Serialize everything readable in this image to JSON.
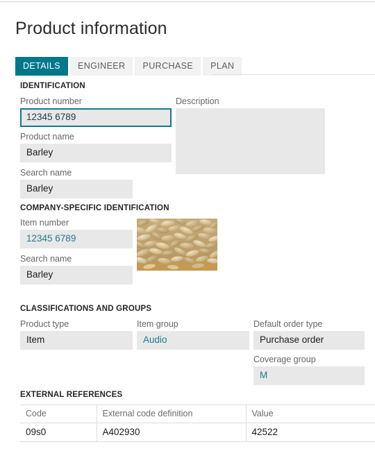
{
  "page": {
    "title": "Product information"
  },
  "tabs": [
    {
      "label": "DETAILS",
      "active": true
    },
    {
      "label": "ENGINEER",
      "active": false
    },
    {
      "label": "PURCHASE",
      "active": false
    },
    {
      "label": "PLAN",
      "active": false
    }
  ],
  "sections": {
    "identification": "IDENTIFICATION",
    "company_specific": "COMPANY-SPECIFIC IDENTIFICATION",
    "classifications": "CLASSIFICATIONS AND GROUPS",
    "external_references": "EXTERNAL REFERENCES"
  },
  "fields": {
    "product_number": {
      "label": "Product number",
      "value": "12345 6789",
      "placeholder": ""
    },
    "product_name": {
      "label": "Product name",
      "value": "Barley",
      "placeholder": ""
    },
    "search_name_1": {
      "label": "Search name",
      "value": "Barley",
      "placeholder": ""
    },
    "description": {
      "label": "Description",
      "value": "",
      "placeholder": ""
    },
    "item_number": {
      "label": "Item number",
      "value": "12345 6789",
      "placeholder": ""
    },
    "search_name_2": {
      "label": "Search name",
      "value": "Barley",
      "placeholder": ""
    },
    "product_type": {
      "label": "Product type",
      "value": "Item",
      "placeholder": ""
    },
    "item_group": {
      "label": "Item group",
      "value": "Audio",
      "placeholder": ""
    },
    "order_type": {
      "label": "Default order type",
      "value": "Purchase order",
      "placeholder": ""
    },
    "coverage_group": {
      "label": "Coverage group",
      "value": "M",
      "placeholder": ""
    }
  },
  "photo": {
    "name": "product-image",
    "alt": "Barley grains"
  },
  "external_references_table": {
    "columns": [
      "Code",
      "External code definition",
      "Value"
    ],
    "rows": [
      [
        "09s0",
        "A402930",
        "42522"
      ]
    ]
  },
  "colors": {
    "accent": "#00788c",
    "field_background": "#e8e8e8",
    "link_text": "#1f7a8c",
    "label_text": "#666666",
    "heading_text": "#242424",
    "border": "#dcdcdc"
  }
}
